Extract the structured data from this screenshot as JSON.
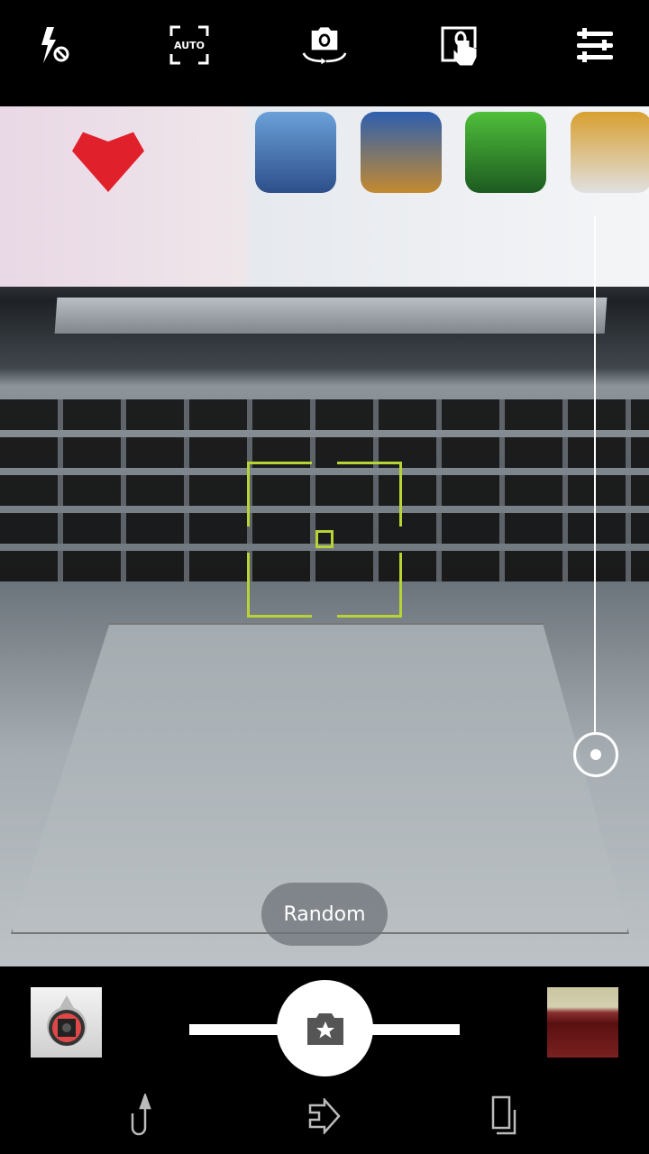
{
  "top_bar": {
    "items": [
      {
        "icon": "flash-off-icon"
      },
      {
        "icon": "auto-focus-icon",
        "label": "AUTO"
      },
      {
        "icon": "switch-camera-icon"
      },
      {
        "icon": "touch-shutter-icon"
      },
      {
        "icon": "settings-sliders-icon"
      }
    ]
  },
  "viewfinder": {
    "focus_color": "#b8d334",
    "zoom_level": 0
  },
  "mode_label": "Random",
  "bottom_bar": {
    "left_thumb": "camera-app-icon",
    "shutter_icon": "camera-star-icon",
    "right_thumb": "last-photo-thumbnail"
  },
  "nav": [
    "back-icon",
    "home-icon",
    "recent-apps-icon"
  ]
}
